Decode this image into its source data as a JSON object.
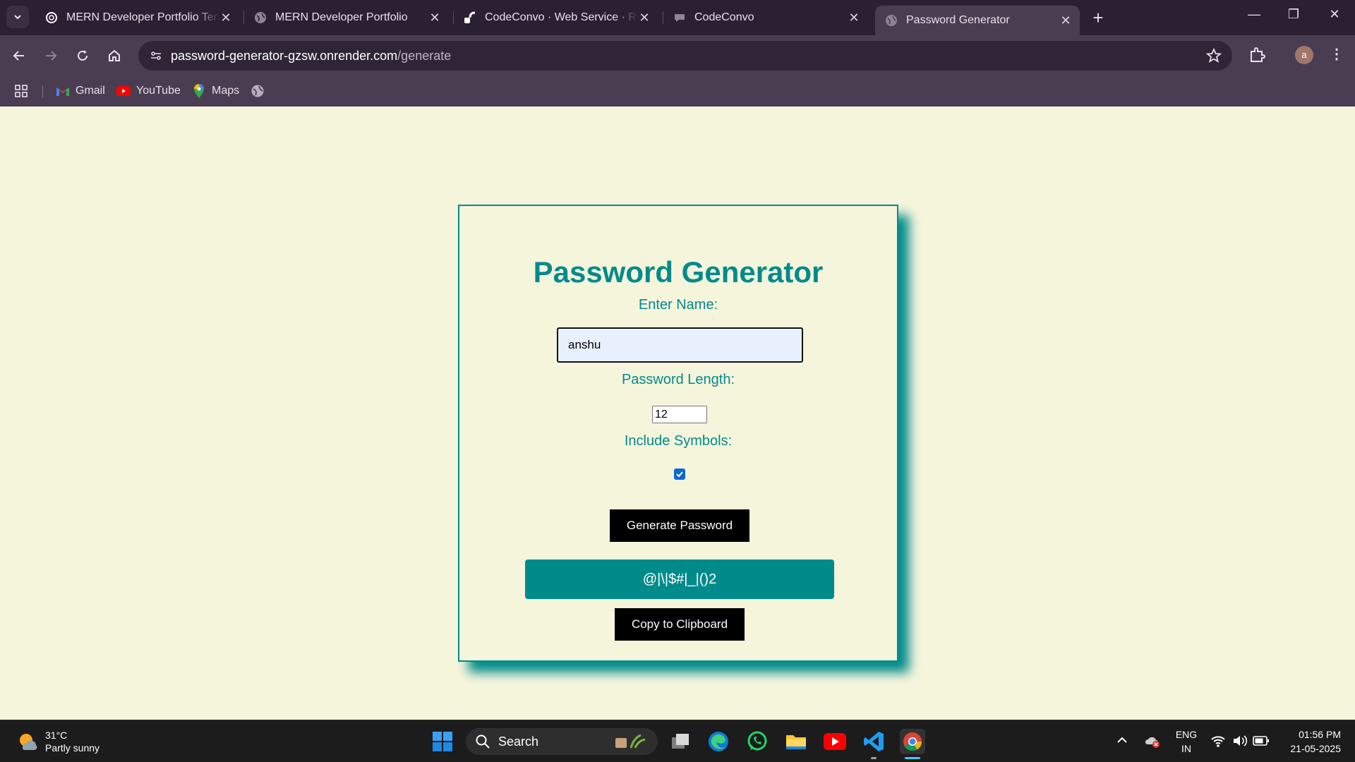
{
  "tabs": [
    {
      "title": "MERN Developer Portfolio Template",
      "icon": "openai-icon"
    },
    {
      "title": "MERN Developer Portfolio",
      "icon": "globe-icon"
    },
    {
      "title": "CodeConvo · Web Service · Render",
      "icon": "render-icon"
    },
    {
      "title": "CodeConvo",
      "icon": "chat-icon"
    },
    {
      "title": "Password Generator",
      "icon": "globe-icon",
      "active": true
    }
  ],
  "address_bar": {
    "domain": "password-generator-gzsw.onrender.com",
    "path": "/generate"
  },
  "profile_initial": "a",
  "bookmarks": [
    {
      "label": "Gmail",
      "icon": "gmail-icon"
    },
    {
      "label": "YouTube",
      "icon": "youtube-icon"
    },
    {
      "label": "Maps",
      "icon": "maps-icon"
    }
  ],
  "page": {
    "title": "Password Generator",
    "name_label": "Enter Name:",
    "name_value": "anshu",
    "length_label": "Password Length:",
    "length_value": "12",
    "symbols_label": "Include Symbols:",
    "symbols_checked": true,
    "generate_button": "Generate Password",
    "generated_password": "@|\\|$#|_|()2",
    "copy_button": "Copy to Clipboard"
  },
  "taskbar": {
    "weather_temp": "31°C",
    "weather_desc": "Partly sunny",
    "search_label": "Search",
    "lang_top": "ENG",
    "lang_bottom": "IN",
    "time": "01:56 PM",
    "date": "21-05-2025"
  },
  "colors": {
    "accent": "#008b8b",
    "page_bg": "#f5f5dc",
    "browser_frame": "#4a3d52"
  }
}
